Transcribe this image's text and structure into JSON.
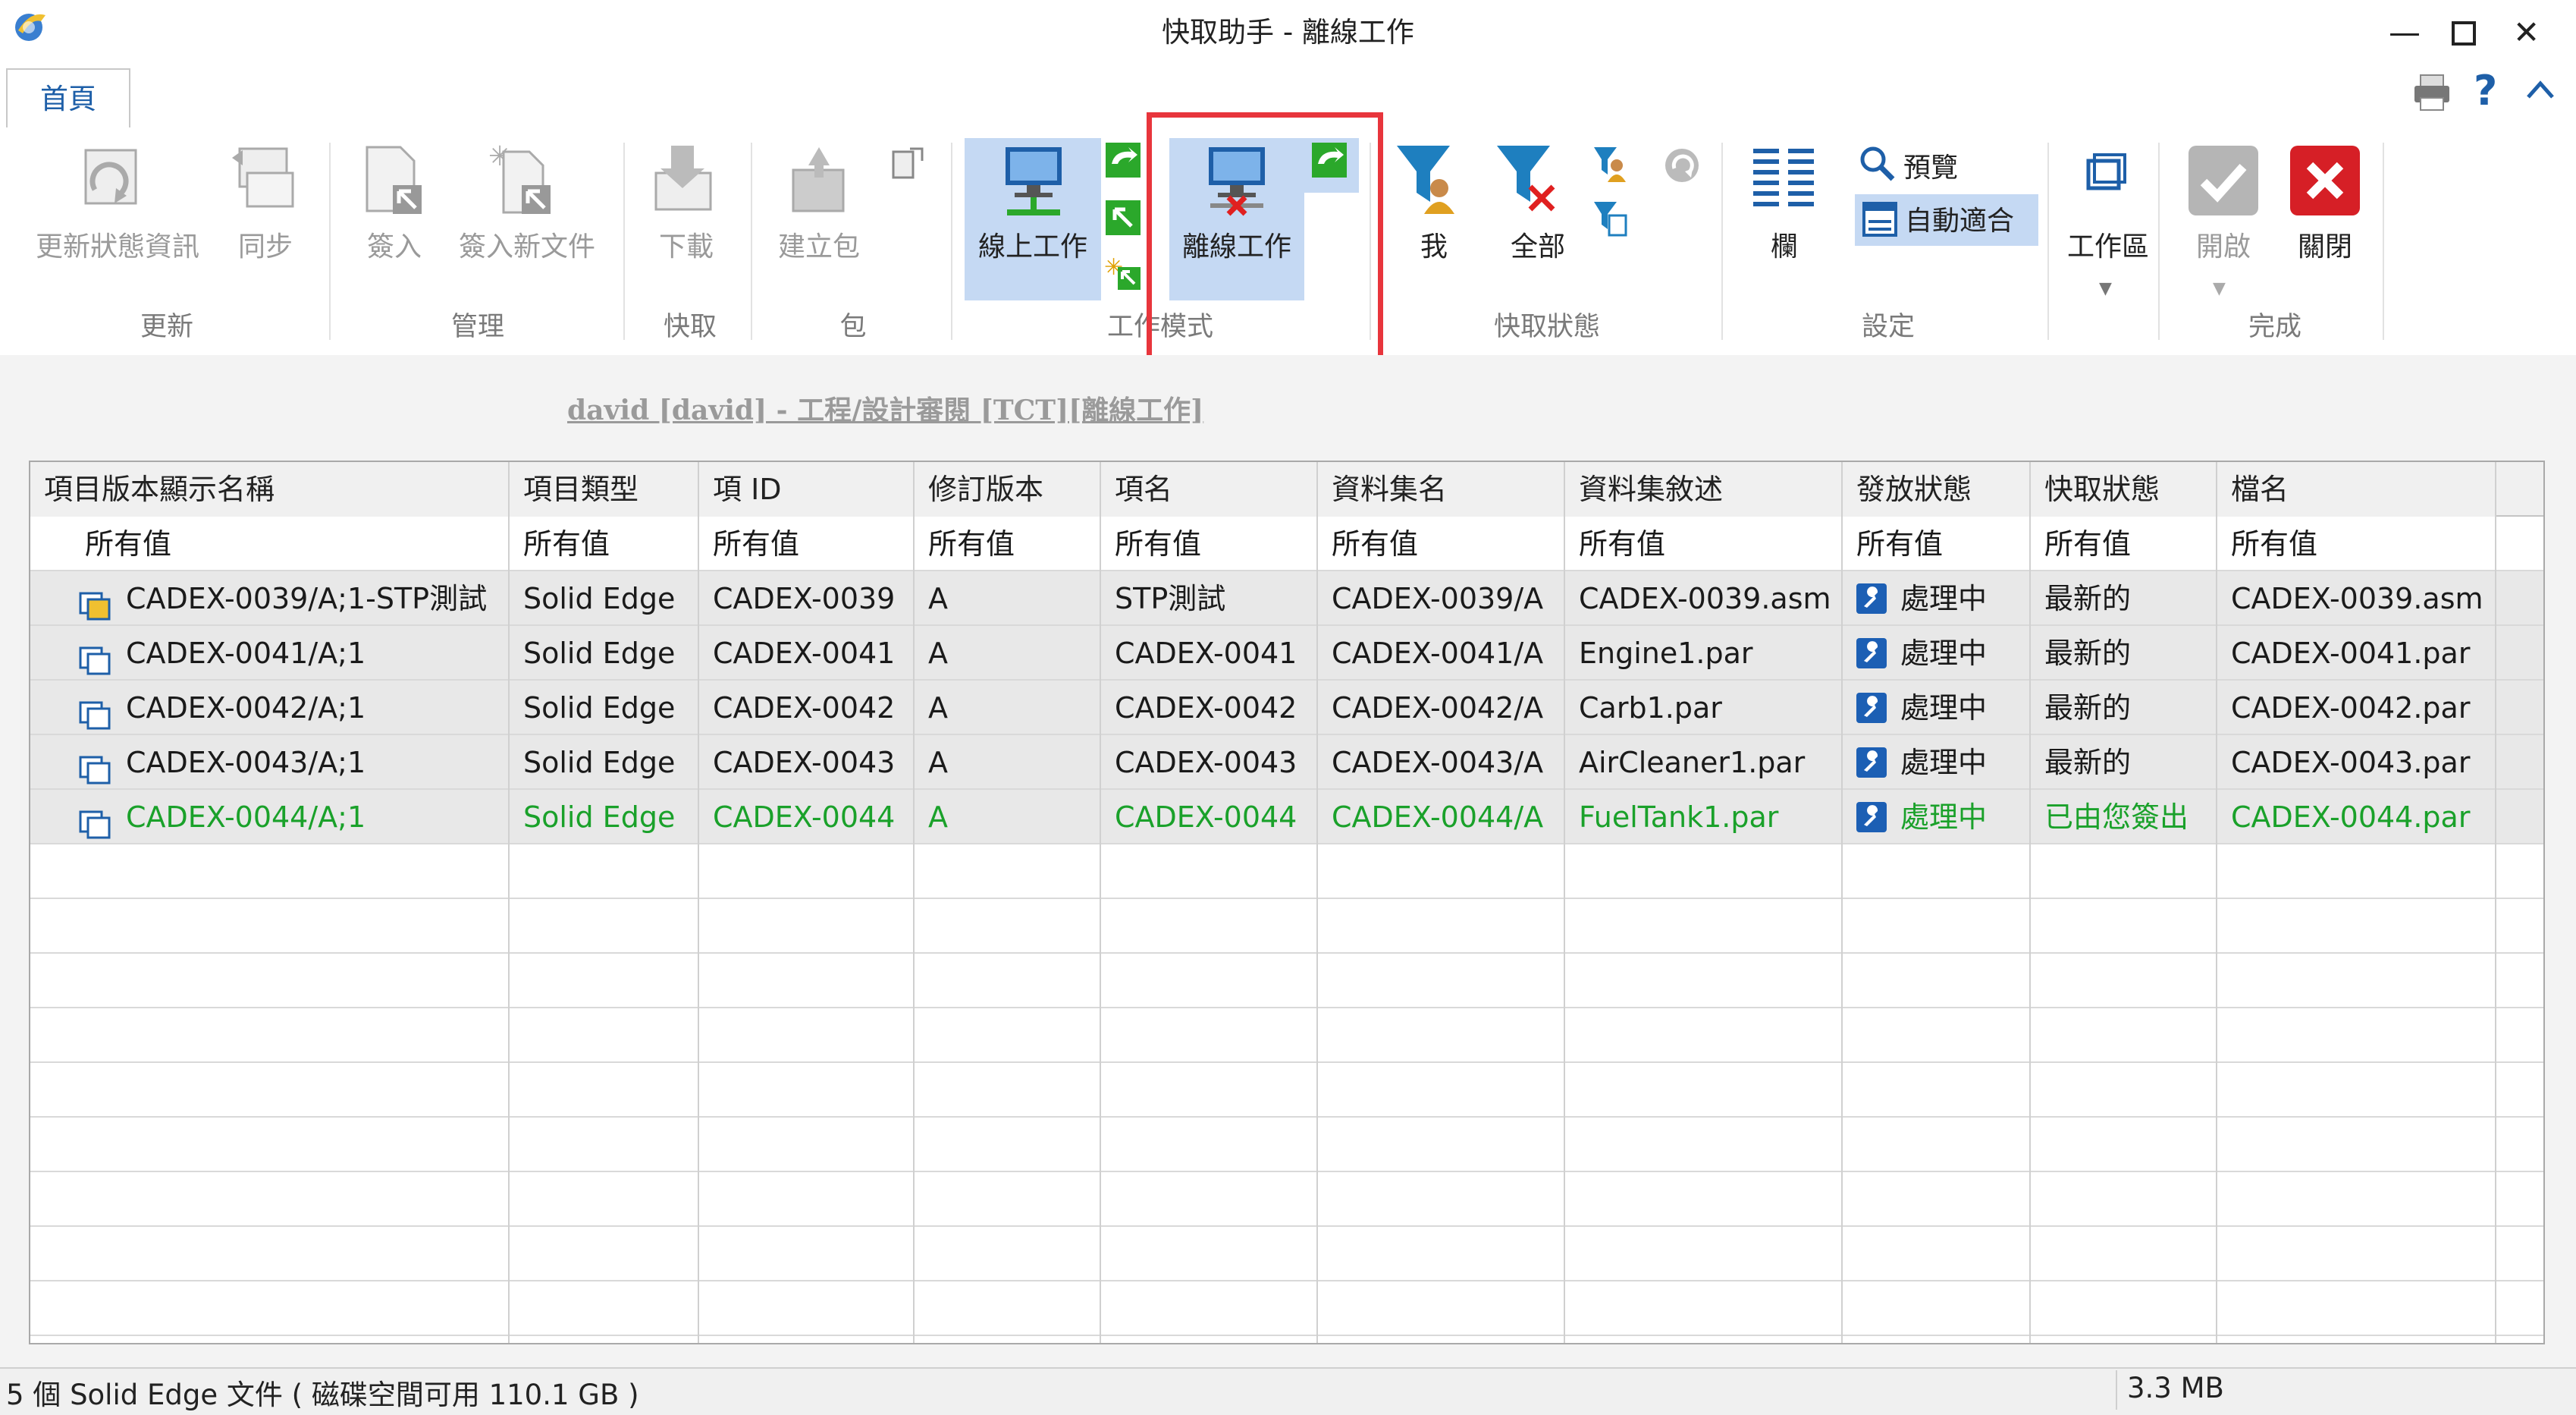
{
  "window": {
    "title": "快取助手 - 離線工作"
  },
  "ribbon": {
    "tab_home": "首頁",
    "groups": {
      "update": "更新",
      "manage": "管理",
      "cache": "快取",
      "package": "包",
      "work_mode": "工作模式",
      "cache_status": "快取狀態",
      "settings": "設定",
      "finish": "完成"
    },
    "buttons": {
      "update_status": "更新狀態資訊",
      "sync": "同步",
      "check_in": "簽入",
      "check_in_new": "簽入新文件",
      "download": "下載",
      "create_package": "建立包",
      "online": "線上工作",
      "offline": "離線工作",
      "me": "我",
      "all": "全部",
      "columns": "欄",
      "preview": "預覽",
      "auto_fit": "自動適合",
      "workspace": "工作區",
      "open": "開啟",
      "close": "關閉"
    }
  },
  "context_link": "david [david] - 工程/設計審閱 [TCT][離線工作]",
  "grid": {
    "columns": [
      "項目版本顯示名稱",
      "項目類型",
      "項 ID",
      "修訂版本",
      "項名",
      "資料集名",
      "資料集敘述",
      "發放狀態",
      "快取狀態",
      "檔名"
    ],
    "filters": [
      "所有值",
      "所有值",
      "所有值",
      "所有值",
      "所有值",
      "所有值",
      "所有值",
      "所有值",
      "所有值",
      "所有值"
    ],
    "rows": [
      [
        "CADEX-0039/A;1-STP測試",
        "Solid Edge",
        "CADEX-0039",
        "A",
        "STP測試",
        "CADEX-0039/A",
        "CADEX-0039.asm",
        "處理中",
        "最新的",
        "CADEX-0039.asm"
      ],
      [
        "CADEX-0041/A;1",
        "Solid Edge",
        "CADEX-0041",
        "A",
        "CADEX-0041",
        "CADEX-0041/A",
        "Engine1.par",
        "處理中",
        "最新的",
        "CADEX-0041.par"
      ],
      [
        "CADEX-0042/A;1",
        "Solid Edge",
        "CADEX-0042",
        "A",
        "CADEX-0042",
        "CADEX-0042/A",
        "Carb1.par",
        "處理中",
        "最新的",
        "CADEX-0042.par"
      ],
      [
        "CADEX-0043/A;1",
        "Solid Edge",
        "CADEX-0043",
        "A",
        "CADEX-0043",
        "CADEX-0043/A",
        "AirCleaner1.par",
        "處理中",
        "最新的",
        "CADEX-0043.par"
      ],
      [
        "CADEX-0044/A;1",
        "Solid Edge",
        "CADEX-0044",
        "A",
        "CADEX-0044",
        "CADEX-0044/A",
        "FuelTank1.par",
        "處理中",
        "已由您簽出",
        "CADEX-0044.par"
      ]
    ]
  },
  "statusbar": {
    "left": "5 個 Solid Edge 文件 ( 磁碟空間可用 110.1 GB )",
    "right": "3.3 MB"
  },
  "colors": {
    "accent_blue": "#1e5fa8",
    "highlight_red": "#e8353c",
    "checked_out_green": "#1aa12a",
    "selected_button": "#c5d9f3"
  }
}
